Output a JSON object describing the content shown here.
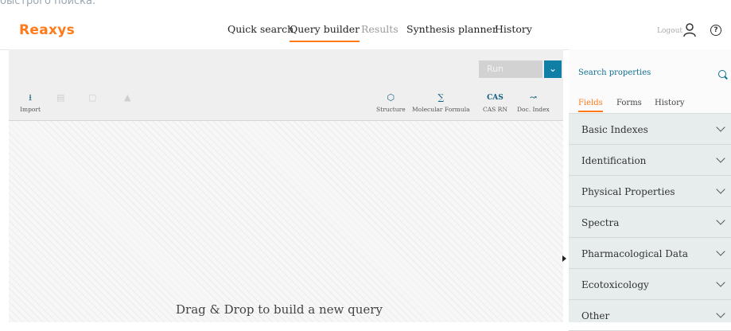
{
  "caption": "быстрого поиска.",
  "header": {
    "logo": "Reaxys",
    "nav": [
      {
        "label": "Quick search"
      },
      {
        "label": "Query builder"
      },
      {
        "label": "Results"
      },
      {
        "label": "Synthesis planner"
      },
      {
        "label": "History"
      }
    ],
    "active_nav": "Query builder",
    "logout": "Logout"
  },
  "toolbar": {
    "run_label": "Run",
    "import_label": "Import",
    "tools": [
      {
        "icon": "structure-icon",
        "label": "Structure"
      },
      {
        "icon": "molecular-formula-icon",
        "label": "Molecular Formula"
      },
      {
        "icon": "cas-icon",
        "label": "CAS RN",
        "glyph": "CAS"
      },
      {
        "icon": "doc-index-icon",
        "label": "Doc. Index"
      }
    ]
  },
  "canvas": {
    "hint": "Drag & Drop to build a new query"
  },
  "panel": {
    "title": "Search properties",
    "tabs": [
      {
        "label": "Fields"
      },
      {
        "label": "Forms"
      },
      {
        "label": "History"
      }
    ],
    "fields": [
      {
        "label": "Basic Indexes"
      },
      {
        "label": "Identification"
      },
      {
        "label": "Physical Properties"
      },
      {
        "label": "Spectra"
      },
      {
        "label": "Pharmacological Data"
      },
      {
        "label": "Ecotoxicology"
      },
      {
        "label": "Other"
      }
    ]
  },
  "colors": {
    "accent": "#ff7a1a",
    "primary": "#0f7fa5"
  }
}
